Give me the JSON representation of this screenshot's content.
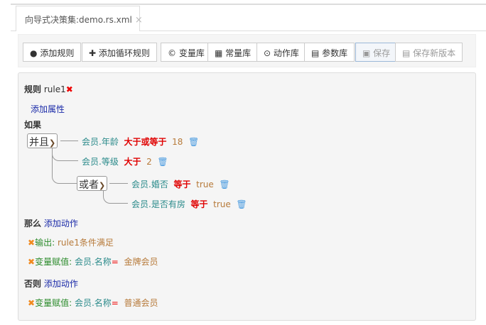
{
  "tab": {
    "title": "向导式决策集:demo.rs.xml",
    "close": "×"
  },
  "toolbar": {
    "add_rule": "添加规则",
    "add_loop_rule": "添加循环规则",
    "variable_lib": "变量库",
    "constant_lib": "常量库",
    "action_lib": "动作库",
    "parameter_lib": "参数库",
    "save": "保存",
    "save_new_version": "保存新版本"
  },
  "rule": {
    "label": "规则",
    "name": "rule1",
    "add_attribute": "添加属性",
    "if_label": "如果",
    "and_op": "并且",
    "or_op": "或者",
    "conditions": [
      {
        "field": "会员.年龄",
        "op": "大于或等于",
        "value": "18"
      },
      {
        "field": "会员.等级",
        "op": "大于",
        "value": "2"
      },
      {
        "field": "会员.婚否",
        "op": "等于",
        "value": "true"
      },
      {
        "field": "会员.是否有房",
        "op": "等于",
        "value": "true"
      }
    ],
    "then_label": "那么",
    "else_label": "否则",
    "add_action": "添加动作",
    "then_actions": [
      {
        "type": "输出:",
        "text": "rule1条件满足"
      },
      {
        "type": "变量赋值:",
        "field": "会员.名称",
        "eq": "=",
        "value": "金牌会员"
      }
    ],
    "else_actions": [
      {
        "type": "变量赋值:",
        "field": "会员.名称",
        "eq": "=",
        "value": "普通会员"
      }
    ]
  }
}
